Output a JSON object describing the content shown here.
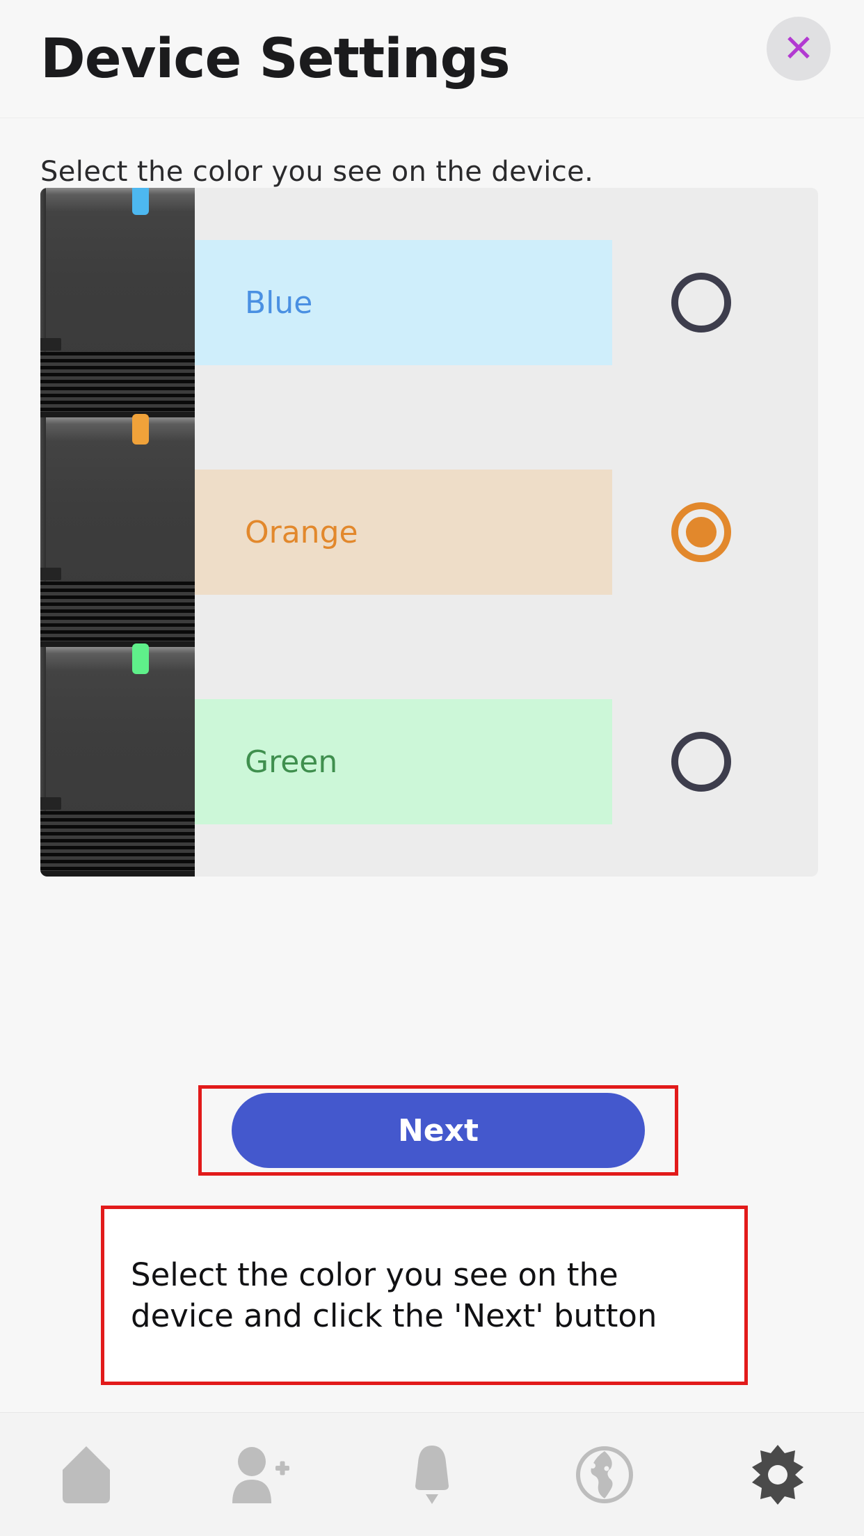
{
  "header": {
    "title": "Device Settings",
    "close_label": "✕",
    "close_icon_color": "#b23ad1"
  },
  "main": {
    "instruction": "Select the color you see on the device.",
    "options": [
      {
        "label": "Blue",
        "band_color": "#cfeefb",
        "text_color": "#4a90e2",
        "led_color": "#4db8f0",
        "selected": false,
        "radio_color": "#3d3d4c"
      },
      {
        "label": "Orange",
        "band_color": "#eeddc8",
        "text_color": "#e2882c",
        "led_color": "#f0a23a",
        "selected": true,
        "radio_color": "#e2882c"
      },
      {
        "label": "Green",
        "band_color": "#ccf7d8",
        "text_color": "#3f8f4e",
        "led_color": "#5ff08a",
        "selected": false,
        "radio_color": "#3d3d4c"
      }
    ]
  },
  "actions": {
    "next_label": "Next",
    "next_color": "#4458cd",
    "highlight_color": "#e21b1b"
  },
  "callout": {
    "line1": "Select the color you see on the",
    "line2": "device and click the 'Next' button"
  },
  "tabbar": {
    "items": [
      {
        "icon": "home-icon",
        "active": false
      },
      {
        "icon": "add-person-icon",
        "active": false
      },
      {
        "icon": "bell-icon",
        "active": false
      },
      {
        "icon": "globe-icon",
        "active": false
      },
      {
        "icon": "gear-icon",
        "active": true
      }
    ],
    "inactive_color": "#bdbdbd",
    "active_color": "#4a4a4a"
  }
}
